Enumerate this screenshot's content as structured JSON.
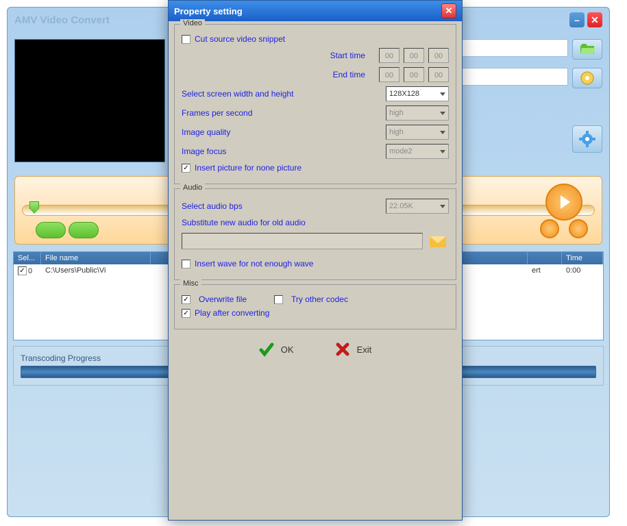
{
  "main": {
    "title": "AMV Video Convert",
    "paths": {
      "src": "",
      "dst": ""
    },
    "table": {
      "columns": [
        "Sel...",
        "File name",
        "",
        "",
        "Time"
      ],
      "row": {
        "sel": "0",
        "checked": true,
        "filename": "C:\\Users\\Public\\Vi",
        "status": "ert",
        "time": "0:00"
      }
    },
    "progress_label": "Transcoding Progress"
  },
  "modal": {
    "title": "Property setting",
    "video": {
      "group_title": "Video",
      "cut_label": "Cut source video snippet",
      "cut_checked": false,
      "start_time_label": "Start time",
      "start_time": [
        "00",
        "00",
        "00"
      ],
      "end_time_label": "End time",
      "end_time": [
        "00",
        "00",
        "00"
      ],
      "screen_label": "Select screen width and height",
      "screen_value": "128X128",
      "fps_label": "Frames per second",
      "fps_value": "high",
      "quality_label": "Image quality",
      "quality_value": "high",
      "focus_label": "Image focus",
      "focus_value": "mode2",
      "insert_pic_label": "Insert picture for none picture",
      "insert_pic_checked": true
    },
    "audio": {
      "group_title": "Audio",
      "bps_label": "Select audio bps",
      "bps_value": "22.05K",
      "substitute_label": "Substitute new audio for old audio",
      "insert_wave_label": "Insert wave for not enough wave",
      "insert_wave_checked": false
    },
    "misc": {
      "group_title": "Misc",
      "overwrite_label": "Overwrite file",
      "overwrite_checked": true,
      "try_codec_label": "Try other codec",
      "try_codec_checked": false,
      "play_after_label": "Play after converting",
      "play_after_checked": true
    },
    "buttons": {
      "ok": "OK",
      "exit": "Exit"
    }
  }
}
